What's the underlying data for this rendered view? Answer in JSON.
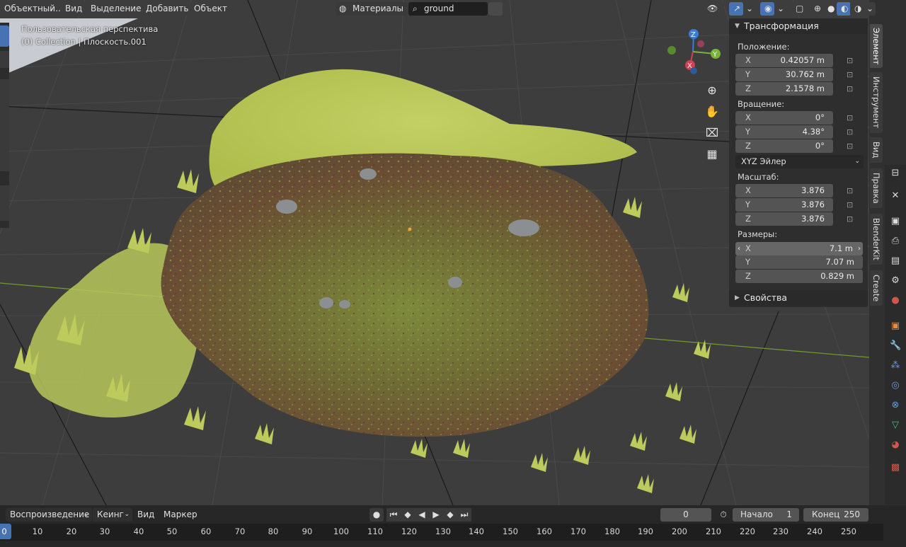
{
  "header": {
    "mode_label": "Объектный...",
    "menus": [
      "Вид",
      "Выделение",
      "Добавить",
      "Объект"
    ],
    "material_label": "Материалы",
    "search_value": "ground"
  },
  "viewport": {
    "overlay_line1": "Пользовательская перспектива",
    "overlay_line2": "(0) Collection | Плоскость.001",
    "gizmo": {
      "x": "Y",
      "y": "Y",
      "z": "Z",
      "nx": "X"
    }
  },
  "npanel": {
    "transform_title": "Трансформация",
    "location_label": "Положение:",
    "location": [
      {
        "axis": "X",
        "value": "0.42057 m"
      },
      {
        "axis": "Y",
        "value": "30.762 m"
      },
      {
        "axis": "Z",
        "value": "2.1578 m"
      }
    ],
    "rotation_label": "Вращение:",
    "rotation": [
      {
        "axis": "X",
        "value": "0°"
      },
      {
        "axis": "Y",
        "value": "4.38°"
      },
      {
        "axis": "Z",
        "value": "0°"
      }
    ],
    "rotation_mode": "XYZ Эйлер",
    "scale_label": "Масштаб:",
    "scale": [
      {
        "axis": "X",
        "value": "3.876"
      },
      {
        "axis": "Y",
        "value": "3.876"
      },
      {
        "axis": "Z",
        "value": "3.876"
      }
    ],
    "dimensions_label": "Размеры:",
    "dimensions": [
      {
        "axis": "X",
        "value": "7.1 m"
      },
      {
        "axis": "Y",
        "value": "7.07 m"
      },
      {
        "axis": "Z",
        "value": "0.829 m"
      }
    ],
    "properties_title": "Свойства"
  },
  "vtabs": [
    "Элемент",
    "Инструмент",
    "Вид",
    "Правка",
    "BlenderKit",
    "Create"
  ],
  "timeline": {
    "playback_label": "Воспроизведение",
    "keying_label": "Кеинг",
    "view_label": "Вид",
    "marker_label": "Маркер",
    "current_frame": "0",
    "start_label": "Начало",
    "start_value": "1",
    "end_label": "Конец",
    "end_value": "250",
    "ticks": [
      "0",
      "10",
      "20",
      "30",
      "40",
      "50",
      "60",
      "70",
      "80",
      "90",
      "100",
      "110",
      "120",
      "130",
      "140",
      "150",
      "160",
      "170",
      "180",
      "190",
      "200",
      "210",
      "220",
      "230",
      "240",
      "250"
    ]
  }
}
